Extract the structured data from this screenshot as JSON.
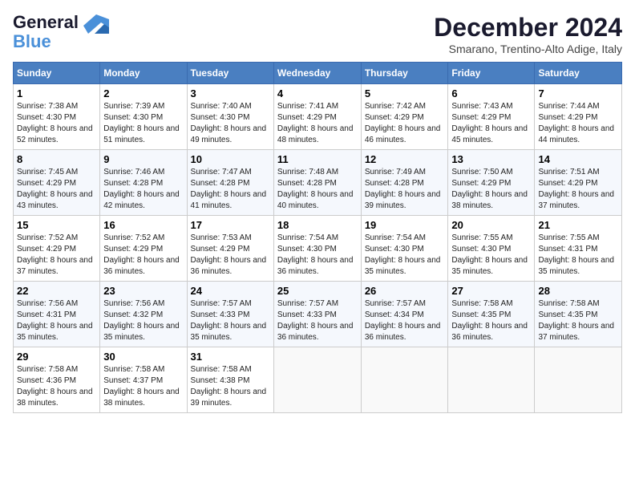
{
  "logo": {
    "line1": "General",
    "line2": "Blue"
  },
  "title": "December 2024",
  "subtitle": "Smarano, Trentino-Alto Adige, Italy",
  "days_header": [
    "Sunday",
    "Monday",
    "Tuesday",
    "Wednesday",
    "Thursday",
    "Friday",
    "Saturday"
  ],
  "weeks": [
    [
      {
        "day": "1",
        "sunrise": "7:38 AM",
        "sunset": "4:30 PM",
        "daylight": "8 hours and 52 minutes."
      },
      {
        "day": "2",
        "sunrise": "7:39 AM",
        "sunset": "4:30 PM",
        "daylight": "8 hours and 51 minutes."
      },
      {
        "day": "3",
        "sunrise": "7:40 AM",
        "sunset": "4:30 PM",
        "daylight": "8 hours and 49 minutes."
      },
      {
        "day": "4",
        "sunrise": "7:41 AM",
        "sunset": "4:29 PM",
        "daylight": "8 hours and 48 minutes."
      },
      {
        "day": "5",
        "sunrise": "7:42 AM",
        "sunset": "4:29 PM",
        "daylight": "8 hours and 46 minutes."
      },
      {
        "day": "6",
        "sunrise": "7:43 AM",
        "sunset": "4:29 PM",
        "daylight": "8 hours and 45 minutes."
      },
      {
        "day": "7",
        "sunrise": "7:44 AM",
        "sunset": "4:29 PM",
        "daylight": "8 hours and 44 minutes."
      }
    ],
    [
      {
        "day": "8",
        "sunrise": "7:45 AM",
        "sunset": "4:29 PM",
        "daylight": "8 hours and 43 minutes."
      },
      {
        "day": "9",
        "sunrise": "7:46 AM",
        "sunset": "4:28 PM",
        "daylight": "8 hours and 42 minutes."
      },
      {
        "day": "10",
        "sunrise": "7:47 AM",
        "sunset": "4:28 PM",
        "daylight": "8 hours and 41 minutes."
      },
      {
        "day": "11",
        "sunrise": "7:48 AM",
        "sunset": "4:28 PM",
        "daylight": "8 hours and 40 minutes."
      },
      {
        "day": "12",
        "sunrise": "7:49 AM",
        "sunset": "4:28 PM",
        "daylight": "8 hours and 39 minutes."
      },
      {
        "day": "13",
        "sunrise": "7:50 AM",
        "sunset": "4:29 PM",
        "daylight": "8 hours and 38 minutes."
      },
      {
        "day": "14",
        "sunrise": "7:51 AM",
        "sunset": "4:29 PM",
        "daylight": "8 hours and 37 minutes."
      }
    ],
    [
      {
        "day": "15",
        "sunrise": "7:52 AM",
        "sunset": "4:29 PM",
        "daylight": "8 hours and 37 minutes."
      },
      {
        "day": "16",
        "sunrise": "7:52 AM",
        "sunset": "4:29 PM",
        "daylight": "8 hours and 36 minutes."
      },
      {
        "day": "17",
        "sunrise": "7:53 AM",
        "sunset": "4:29 PM",
        "daylight": "8 hours and 36 minutes."
      },
      {
        "day": "18",
        "sunrise": "7:54 AM",
        "sunset": "4:30 PM",
        "daylight": "8 hours and 36 minutes."
      },
      {
        "day": "19",
        "sunrise": "7:54 AM",
        "sunset": "4:30 PM",
        "daylight": "8 hours and 35 minutes."
      },
      {
        "day": "20",
        "sunrise": "7:55 AM",
        "sunset": "4:30 PM",
        "daylight": "8 hours and 35 minutes."
      },
      {
        "day": "21",
        "sunrise": "7:55 AM",
        "sunset": "4:31 PM",
        "daylight": "8 hours and 35 minutes."
      }
    ],
    [
      {
        "day": "22",
        "sunrise": "7:56 AM",
        "sunset": "4:31 PM",
        "daylight": "8 hours and 35 minutes."
      },
      {
        "day": "23",
        "sunrise": "7:56 AM",
        "sunset": "4:32 PM",
        "daylight": "8 hours and 35 minutes."
      },
      {
        "day": "24",
        "sunrise": "7:57 AM",
        "sunset": "4:33 PM",
        "daylight": "8 hours and 35 minutes."
      },
      {
        "day": "25",
        "sunrise": "7:57 AM",
        "sunset": "4:33 PM",
        "daylight": "8 hours and 36 minutes."
      },
      {
        "day": "26",
        "sunrise": "7:57 AM",
        "sunset": "4:34 PM",
        "daylight": "8 hours and 36 minutes."
      },
      {
        "day": "27",
        "sunrise": "7:58 AM",
        "sunset": "4:35 PM",
        "daylight": "8 hours and 36 minutes."
      },
      {
        "day": "28",
        "sunrise": "7:58 AM",
        "sunset": "4:35 PM",
        "daylight": "8 hours and 37 minutes."
      }
    ],
    [
      {
        "day": "29",
        "sunrise": "7:58 AM",
        "sunset": "4:36 PM",
        "daylight": "8 hours and 38 minutes."
      },
      {
        "day": "30",
        "sunrise": "7:58 AM",
        "sunset": "4:37 PM",
        "daylight": "8 hours and 38 minutes."
      },
      {
        "day": "31",
        "sunrise": "7:58 AM",
        "sunset": "4:38 PM",
        "daylight": "8 hours and 39 minutes."
      },
      null,
      null,
      null,
      null
    ]
  ]
}
